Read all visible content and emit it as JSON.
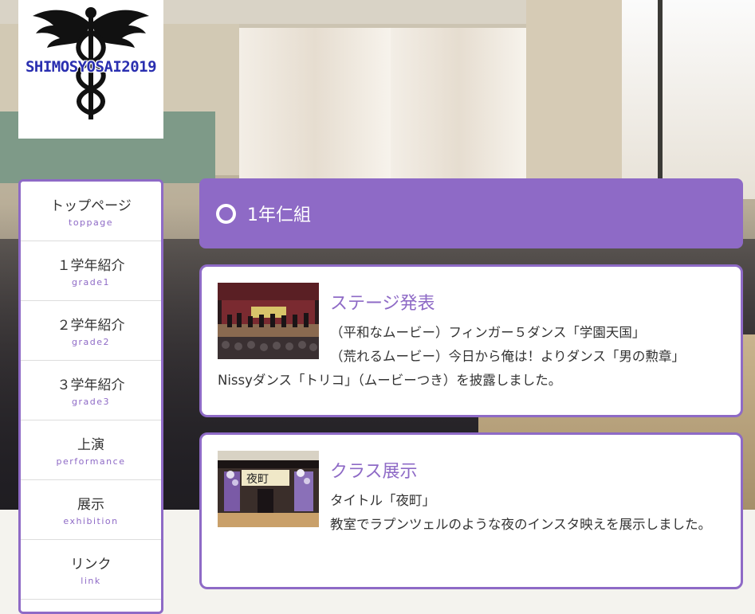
{
  "logo": {
    "text": "SHIMOSYOSAI2019"
  },
  "nav": [
    {
      "label": "トップページ",
      "sub": "toppage"
    },
    {
      "label": "１学年紹介",
      "sub": "grade1"
    },
    {
      "label": "２学年紹介",
      "sub": "grade2"
    },
    {
      "label": "３学年紹介",
      "sub": "grade3"
    },
    {
      "label": "上演",
      "sub": "performance"
    },
    {
      "label": "展示",
      "sub": "exhibition"
    },
    {
      "label": "リンク",
      "sub": "link"
    }
  ],
  "page": {
    "title": "1年仁組"
  },
  "cards": [
    {
      "title": "ステージ発表",
      "lines": [
        "（平和なムービー）フィンガー５ダンス「学園天国」",
        "（荒れるムービー）今日から俺は！よりダンス「男の勲章」",
        "Nissyダンス「トリコ」（ムービーつき）を披露しました。"
      ]
    },
    {
      "title": "クラス展示",
      "lines": [
        "タイトル「夜町」",
        "教室でラプンツェルのような夜のインスタ映えを展示しました。"
      ]
    }
  ],
  "colors": {
    "accent": "#8e6ac6"
  }
}
